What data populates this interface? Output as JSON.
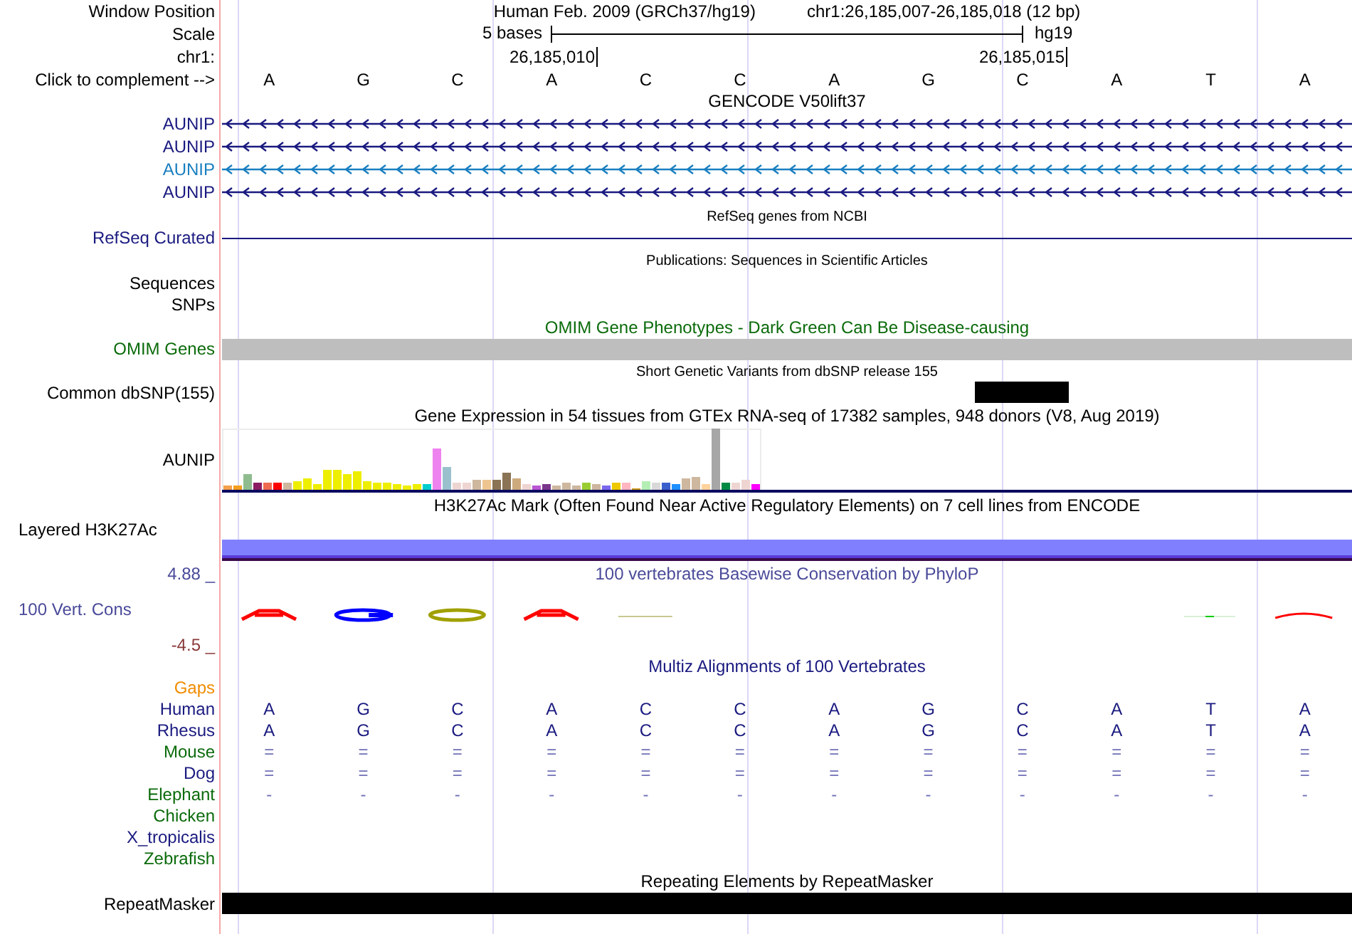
{
  "header": {
    "position_label": "Window Position",
    "assembly": "Human Feb. 2009 (GRCh37/hg19)",
    "position": "chr1:26,185,007-26,185,018 (12 bp)",
    "scale_label": "Scale",
    "scale_text": "5 bases",
    "scale_db": "hg19",
    "chrom_label": "chr1:",
    "ticks": [
      "26,185,010",
      "26,185,015"
    ],
    "complement_label": "Click to complement -->",
    "bases": [
      "A",
      "G",
      "C",
      "A",
      "C",
      "C",
      "A",
      "G",
      "C",
      "A",
      "T",
      "A"
    ]
  },
  "tracks": [
    {
      "kind": "gene",
      "title": "GENCODE V50lift37",
      "items": [
        {
          "name": "AUNIP",
          "color": "#1a1a80"
        },
        {
          "name": "AUNIP",
          "color": "#1a1a80"
        },
        {
          "name": "AUNIP",
          "color": "#1a7fc0"
        },
        {
          "name": "AUNIP",
          "color": "#1a1a80"
        }
      ]
    },
    {
      "kind": "line",
      "title": "RefSeq genes from NCBI",
      "label": "RefSeq Curated"
    },
    {
      "kind": "labels",
      "title": "Publications: Sequences in Scientific Articles",
      "labels": [
        "Sequences",
        "SNPs"
      ]
    },
    {
      "kind": "bar",
      "title": "OMIM Gene Phenotypes - Dark Green Can Be Disease-causing",
      "label": "OMIM Genes"
    },
    {
      "kind": "snp",
      "title": "Short Genetic Variants from dbSNP release 155",
      "label": "Common dbSNP(155)"
    },
    {
      "kind": "expression",
      "title": "Gene Expression in 54 tissues from GTEx RNA-seq of 17382 samples, 948 donors (V8, Aug 2019)",
      "label": "AUNIP"
    },
    {
      "kind": "h3k27ac",
      "title": "H3K27Ac Mark (Often Found Near Active Regulatory Elements) on 7 cell lines from ENCODE",
      "label": "Layered H3K27Ac"
    },
    {
      "kind": "conservation",
      "title": "100 vertebrates Basewise Conservation by PhyloP",
      "label": "100 Vert. Cons",
      "max": "4.88 _",
      "min": "-4.5 _"
    },
    {
      "kind": "multiz",
      "title": "Multiz Alignments of 100 Vertebrates",
      "species": [
        {
          "name": "Gaps",
          "color": "#f08c00"
        },
        {
          "name": "Human",
          "color": "#1a1a80",
          "bases": [
            "A",
            "G",
            "C",
            "A",
            "C",
            "C",
            "A",
            "G",
            "C",
            "A",
            "T",
            "A"
          ]
        },
        {
          "name": "Rhesus",
          "color": "#1a1a80",
          "bases": [
            "A",
            "G",
            "C",
            "A",
            "C",
            "C",
            "A",
            "G",
            "C",
            "A",
            "T",
            "A"
          ]
        },
        {
          "name": "Mouse",
          "color": "#0b6b0b",
          "bases": [
            "=",
            "=",
            "=",
            "=",
            "=",
            "=",
            "=",
            "=",
            "=",
            "=",
            "=",
            "="
          ]
        },
        {
          "name": "Dog",
          "color": "#1a1a80",
          "bases": [
            "=",
            "=",
            "=",
            "=",
            "=",
            "=",
            "=",
            "=",
            "=",
            "=",
            "=",
            "="
          ]
        },
        {
          "name": "Elephant",
          "color": "#0b6b0b",
          "bases": [
            "-",
            "-",
            "-",
            "-",
            "-",
            "-",
            "-",
            "-",
            "-",
            "-",
            "-",
            "-"
          ]
        },
        {
          "name": "Chicken",
          "color": "#0b6b0b"
        },
        {
          "name": "X_tropicalis",
          "color": "#1a1a80"
        },
        {
          "name": "Zebrafish",
          "color": "#0b6b0b"
        }
      ]
    },
    {
      "kind": "repeat",
      "title": "Repeating Elements by RepeatMasker",
      "label": "RepeatMasker"
    }
  ]
}
